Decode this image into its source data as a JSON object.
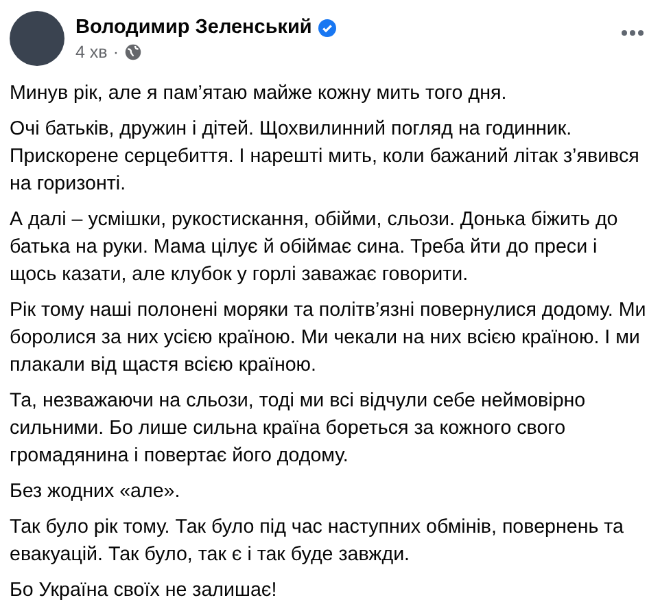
{
  "post": {
    "author": "Володимир Зеленський",
    "verified": true,
    "time": "4 хв",
    "separator": "·",
    "paragraphs": [
      "Минув рік, але я пам’ятаю майже кожну мить того дня.",
      "Очі батьків, дружин і дітей. Щохвилинний погляд на годинник. Прискорене серцебиття. І нарешті мить, коли бажаний літак з’явився на горизонті.",
      "А далі – усмішки, рукостискання, обійми, сльози. Донька біжить до батька на руки. Мама цілує й обіймає сина. Треба йти до преси і щось казати, але клубок у горлі заважає говорити.",
      "Рік тому наші полонені моряки та політв’язні повернулися додому. Ми боролися за них усією країною. Ми чекали на них всією країною. І ми плакали від щастя всією країною.",
      "Та, незважаючи на сльози, тоді ми всі відчули себе неймовірно сильними. Бо лише сильна країна бореться за кожного свого громадянина і повертає його додому.",
      "Без жодних «але».",
      "Так було рік тому. Так було під час наступних обмінів, повернень та евакуацій. Так було, так є і так буде завжди.",
      "Бо Україна своїх не залишає!"
    ]
  }
}
